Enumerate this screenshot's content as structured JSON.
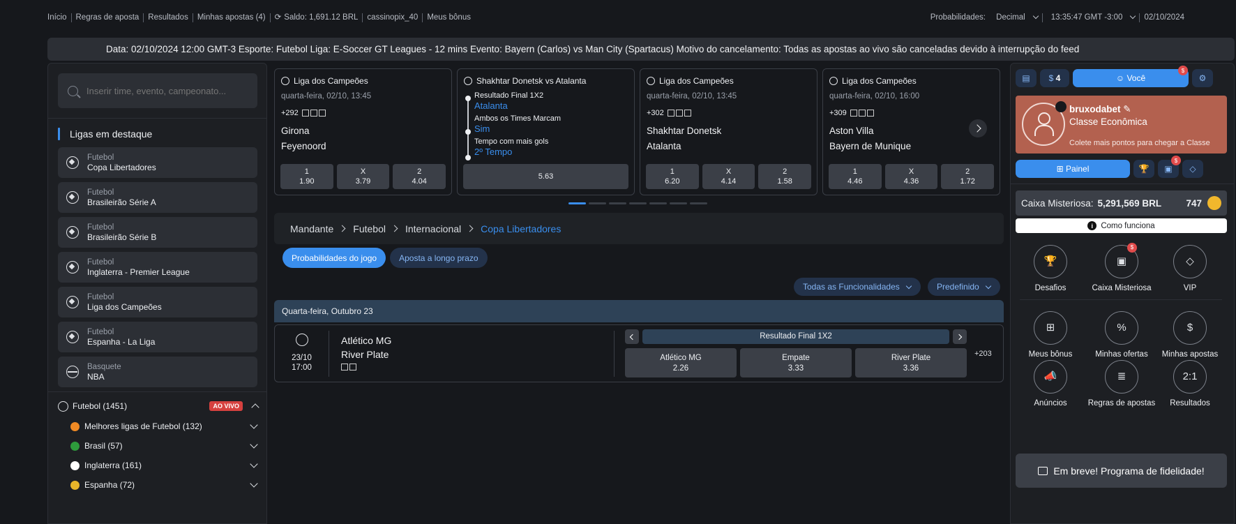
{
  "topbar": {
    "nav": [
      "Início",
      "Regras de aposta",
      "Resultados",
      "Minhas apostas (4)"
    ],
    "balance": "Saldo: 1,691.12 BRL",
    "username": "cassinopix_40",
    "bonus": "Meus bônus",
    "odds_label": "Probabilidades:",
    "odds_format": "Decimal",
    "time": "13:35:47 GMT -3:00",
    "date": "02/10/2024"
  },
  "banner": "Data: 02/10/2024 12:00 GMT-3 Esporte: Futebol Liga: E-Soccer GT Leagues - 12 mins Evento: Bayern (Carlos) vs Man City (Spartacus) Motivo do cancelamento: Todas as apostas ao vivo são canceladas devido à interrupção do feed",
  "sidebar": {
    "search_placeholder": "Inserir time, evento, campeonato...",
    "featured_title": "Ligas em destaque",
    "leagues": [
      {
        "sport": "Futebol",
        "name": "Copa Libertadores",
        "icon": "soccer-ball-icon"
      },
      {
        "sport": "Futebol",
        "name": "Brasileirão Série A",
        "icon": "soccer-ball-icon"
      },
      {
        "sport": "Futebol",
        "name": "Brasileirão Série B",
        "icon": "soccer-ball-icon"
      },
      {
        "sport": "Futebol",
        "name": "Inglaterra - Premier League",
        "icon": "soccer-ball-icon"
      },
      {
        "sport": "Futebol",
        "name": "Liga dos Campeões",
        "icon": "soccer-ball-icon"
      },
      {
        "sport": "Futebol",
        "name": "Espanha - La Liga",
        "icon": "soccer-ball-icon"
      },
      {
        "sport": "Basquete",
        "name": "NBA",
        "icon": "basketball-icon"
      }
    ],
    "sport_label": "Futebol",
    "sport_count": "(1451)",
    "live_badge": "AO VIVO",
    "countries": [
      {
        "name": "Melhores ligas de Futebol (132)",
        "flag": "fire-icon",
        "color": "#f08a24"
      },
      {
        "name": "Brasil (57)",
        "flag": "brazil-flag",
        "color": "#2e9b3c"
      },
      {
        "name": "Inglaterra (161)",
        "flag": "england-flag",
        "color": "#ffffff"
      },
      {
        "name": "Espanha (72)",
        "flag": "spain-flag",
        "color": "#e8b52a"
      }
    ]
  },
  "cards": [
    {
      "league": "Liga dos Campeões",
      "date": "quarta-feira, 02/10, 13:45",
      "markets": "+292",
      "home": "Girona",
      "away": "Feyenoord",
      "odds": [
        {
          "l": "1",
          "v": "1.90"
        },
        {
          "l": "X",
          "v": "3.79"
        },
        {
          "l": "2",
          "v": "4.04"
        }
      ]
    },
    {
      "league": "Shakhtar Donetsk vs Atalanta",
      "props": [
        {
          "q": "Resultado Final 1X2",
          "a": "Atalanta"
        },
        {
          "q": "Ambos os Times Marcam",
          "a": "Sim"
        },
        {
          "q": "Tempo com mais gols",
          "a": "2º Tempo"
        }
      ],
      "price": "5.63"
    },
    {
      "league": "Liga dos Campeões",
      "date": "quarta-feira, 02/10, 13:45",
      "markets": "+302",
      "home": "Shakhtar Donetsk",
      "away": "Atalanta",
      "odds": [
        {
          "l": "1",
          "v": "6.20"
        },
        {
          "l": "X",
          "v": "4.14"
        },
        {
          "l": "2",
          "v": "1.58"
        }
      ]
    },
    {
      "league": "Liga dos Campeões",
      "date": "quarta-feira, 02/10, 16:00",
      "markets": "+309",
      "home": "Aston Villa",
      "away": "Bayern de Munique",
      "odds": [
        {
          "l": "1",
          "v": "4.46"
        },
        {
          "l": "X",
          "v": "4.36"
        },
        {
          "l": "2",
          "v": "1.72"
        }
      ]
    }
  ],
  "breadcrumb": [
    "Mandante",
    "Futebol",
    "Internacional",
    "Copa Libertadores"
  ],
  "tabs": [
    "Probabilidades do jogo",
    "Aposta a longo prazo"
  ],
  "filters": {
    "features": "Todas as Funcionalidades",
    "preset": "Predefinido"
  },
  "day_header": "Quarta-feira,  Outubro 23",
  "match": {
    "date": "23/10",
    "time": "17:00",
    "home": "Atlético MG",
    "away": "River Plate",
    "market": "Resultado Final 1X2",
    "odds": [
      {
        "l": "Atlético MG",
        "v": "2.26"
      },
      {
        "l": "Empate",
        "v": "3.33"
      },
      {
        "l": "River Plate",
        "v": "3.36"
      }
    ],
    "more": "+203"
  },
  "right": {
    "bets_count": "4",
    "you_label": "Você",
    "notif_badge": "$",
    "username": "bruxodabet",
    "class": "Classe Econômica",
    "points_text": "Colete mais pontos para chegar a Classe",
    "panel_label": "Painel",
    "caixa_label": "Caixa Misteriosa:",
    "caixa_value": "5,291,569 BRL",
    "caixa_count": "747",
    "how_label": "Como funciona",
    "grid": [
      {
        "label": "Desafios",
        "icon": "trophy-icon",
        "glyph": "🏆"
      },
      {
        "label": "Caixa Misteriosa",
        "icon": "mystery-box-icon",
        "glyph": "▣"
      },
      {
        "label": "VIP",
        "icon": "diamond-icon",
        "glyph": "◇"
      },
      {
        "label": "Meus bônus",
        "icon": "gift-icon",
        "glyph": "⊞"
      },
      {
        "label": "Minhas ofertas",
        "icon": "offers-icon",
        "glyph": "%"
      },
      {
        "label": "Minhas apostas",
        "icon": "bets-icon",
        "glyph": "$"
      },
      {
        "label": "Anúncios",
        "icon": "megaphone-icon",
        "glyph": "📣"
      },
      {
        "label": "Regras de apostas",
        "icon": "rules-icon",
        "glyph": "≣"
      },
      {
        "label": "Resultados",
        "icon": "results-icon",
        "glyph": "2:1"
      }
    ],
    "loyalty": "Em breve! Programa de fidelidade!"
  }
}
